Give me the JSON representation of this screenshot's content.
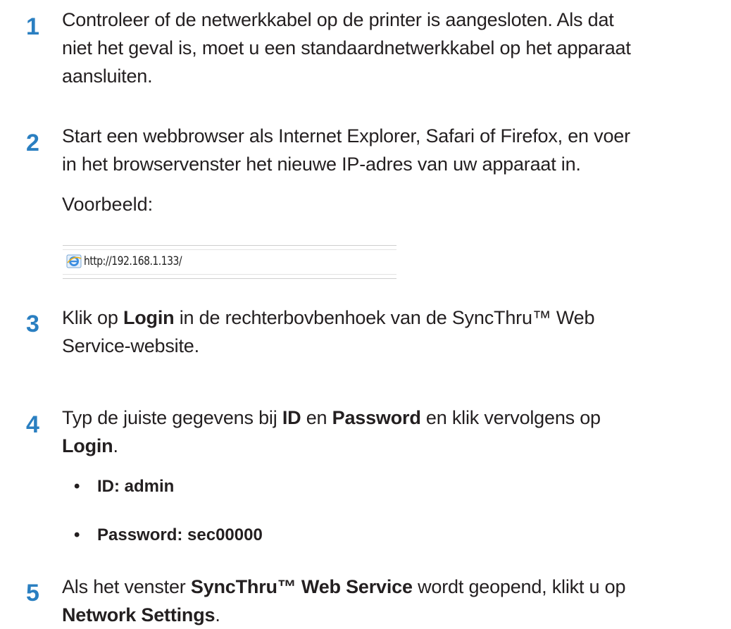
{
  "steps": [
    {
      "number": "1",
      "line1": "Controleer of de netwerkkabel op de printer is aangesloten. Als dat",
      "line2": "niet het geval is, moet u een standaardnetwerkkabel op het apparaat",
      "line3": "aansluiten."
    },
    {
      "number": "2",
      "line1": "Start een webbrowser als Internet Explorer, Safari of Firefox, en voer",
      "line2": "in het browservenster het nieuwe IP-adres van uw apparaat in.",
      "example_label": "Voorbeeld:",
      "example_url": "http://192.168.1.133/"
    },
    {
      "number": "3",
      "line1_pre": "Klik op ",
      "line1_bold": "Login",
      "line1_post": " in de rechterbovbenhoek van de SyncThru™ Web",
      "line2": "Service-website."
    },
    {
      "number": "4",
      "line1_pre": "Typ de juiste gegevens bij ",
      "line1_bold1": "ID",
      "line1_mid": " en ",
      "line1_bold2": "Password",
      "line1_post": " en klik vervolgens op",
      "line2_bold": "Login",
      "line2_post": ".",
      "bullets": [
        {
          "symbol": "•",
          "text": "ID: admin"
        },
        {
          "symbol": "•",
          "text": "Password: sec00000"
        }
      ]
    },
    {
      "number": "5",
      "line1_pre": "Als het venster ",
      "line1_bold": "SyncThru™ Web Service",
      "line1_post": " wordt geopend, klikt u op",
      "line2_bold": "Network Settings",
      "line2_post": "."
    }
  ],
  "colors": {
    "step_number": "#2a7fc1",
    "body_text": "#231f20"
  },
  "icons": {
    "url_icon": "internet-explorer-icon"
  }
}
